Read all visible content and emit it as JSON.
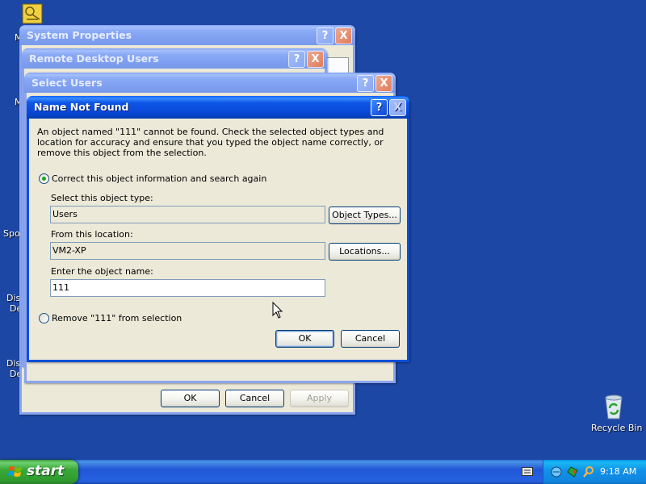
{
  "desktop": {
    "recycle_bin_label": "Recycle Bin",
    "obscured_labels": [
      "M",
      "M",
      "Spo",
      "Dis",
      "De",
      "Dis",
      "De"
    ]
  },
  "windows": {
    "system_properties": {
      "title": "System Properties",
      "ok": "OK",
      "cancel": "Cancel",
      "apply": "Apply"
    },
    "remote_desktop_users": {
      "title": "Remote Desktop Users"
    },
    "select_users": {
      "title": "Select Users"
    }
  },
  "dialog": {
    "title": "Name Not Found",
    "help_glyph": "?",
    "close_glyph": "X",
    "message": "An object named \"111\" cannot be found. Check the selected object types and location for accuracy and ensure that you typed the object name correctly, or remove this object from the selection.",
    "option_correct": "Correct this object information and search again",
    "object_type_label": "Select this object type:",
    "object_type_value": "Users",
    "object_types_button": "Object Types...",
    "location_label": "From this location:",
    "location_value": "VM2-XP",
    "locations_button": "Locations...",
    "object_name_label": "Enter the object name:",
    "object_name_value": "111",
    "option_remove": "Remove \"111\" from selection",
    "ok": "OK",
    "cancel": "Cancel"
  },
  "taskbar": {
    "start_label": "start",
    "clock": "9:18 AM"
  },
  "colors": {
    "desktop": "#1d47a5",
    "titlebar_active": "#0a49d8",
    "window_face": "#ece9d8"
  }
}
